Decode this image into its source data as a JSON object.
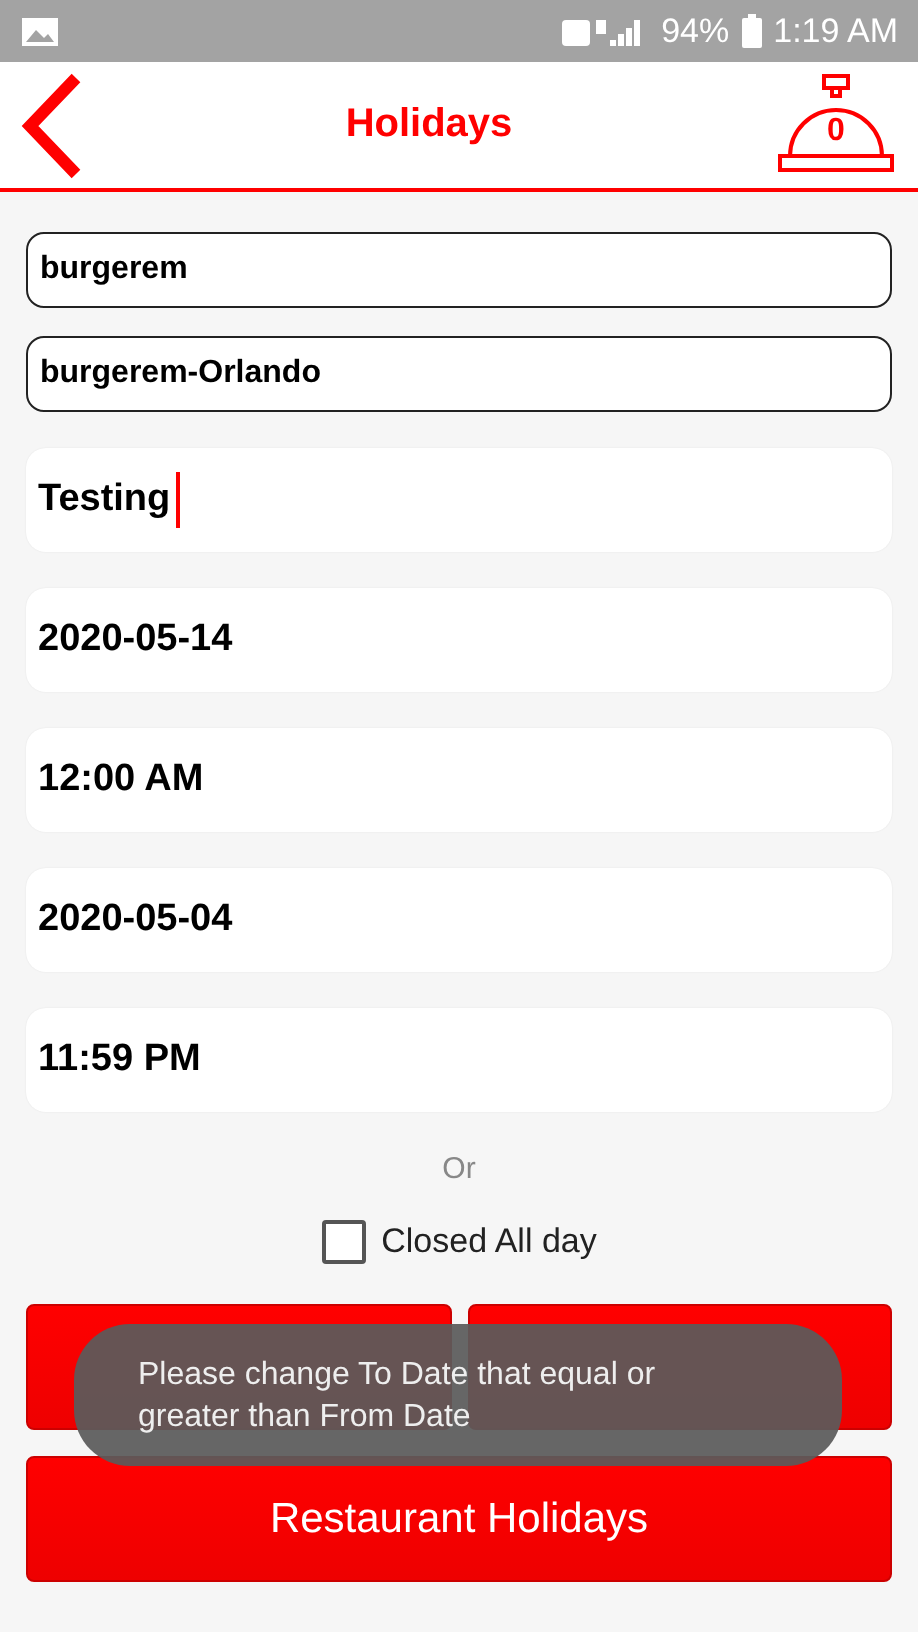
{
  "status_bar": {
    "battery": "94%",
    "time": "1:19 AM"
  },
  "header": {
    "title": "Holidays",
    "cart_count": "0"
  },
  "fields": [
    {
      "kind": "outlined",
      "value": "burgerem",
      "focused": false
    },
    {
      "kind": "outlined",
      "value": "burgerem-Orlando",
      "focused": false
    },
    {
      "kind": "card",
      "value": "Testing",
      "focused": true
    },
    {
      "kind": "card",
      "value": "2020-05-14",
      "focused": false
    },
    {
      "kind": "card",
      "value": "12:00 AM",
      "focused": false
    },
    {
      "kind": "card",
      "value": "2020-05-04",
      "focused": false
    },
    {
      "kind": "card",
      "value": "11:59 PM",
      "focused": false
    }
  ],
  "separator": "Or",
  "closed_all_day": {
    "label": "Closed All day",
    "checked": false
  },
  "buttons": [
    {
      "kind": "action"
    },
    {
      "kind": "action"
    }
  ],
  "main_button": "Restaurant Holidays",
  "toast": "Please change To Date that equal or greater than From Date"
}
